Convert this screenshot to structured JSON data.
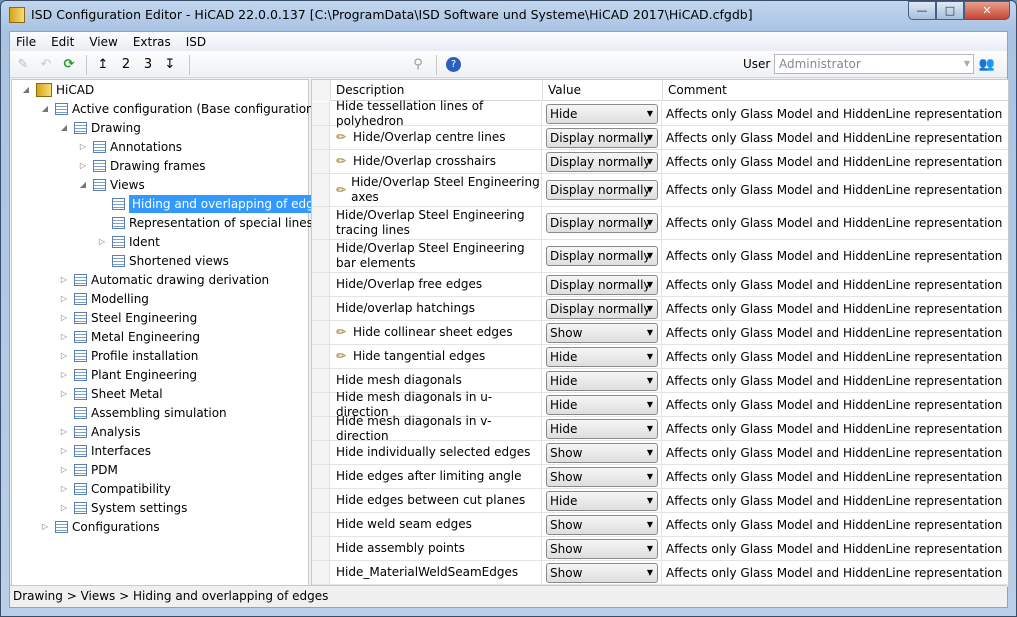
{
  "window": {
    "title": "ISD Configuration Editor  - HiCAD 22.0.0.137 [C:\\ProgramData\\ISD Software und Systeme\\HiCAD 2017\\HiCAD.cfgdb]",
    "minimize": "—",
    "maximize": "□",
    "close": "✕"
  },
  "menu": [
    "File",
    "Edit",
    "View",
    "Extras",
    "ISD"
  ],
  "toolbar": {
    "user_label": "User",
    "user_value": "Administrator"
  },
  "tree": [
    {
      "label": "HiCAD",
      "level": 0,
      "exp": "◢",
      "root": true
    },
    {
      "label": "Active configuration (Base configuration)",
      "level": 1,
      "exp": "◢"
    },
    {
      "label": "Drawing",
      "level": 2,
      "exp": "◢"
    },
    {
      "label": "Annotations",
      "level": 3,
      "exp": "▷"
    },
    {
      "label": "Drawing frames",
      "level": 3,
      "exp": "▷"
    },
    {
      "label": "Views",
      "level": 3,
      "exp": "◢"
    },
    {
      "label": "Hiding and overlapping of edges",
      "level": 4,
      "exp": "",
      "selected": true
    },
    {
      "label": "Representation of special lines",
      "level": 4,
      "exp": ""
    },
    {
      "label": "Ident",
      "level": 4,
      "exp": "▷"
    },
    {
      "label": "Shortened views",
      "level": 4,
      "exp": ""
    },
    {
      "label": "Automatic drawing derivation",
      "level": 2,
      "exp": "▷"
    },
    {
      "label": "Modelling",
      "level": 2,
      "exp": "▷"
    },
    {
      "label": "Steel Engineering",
      "level": 2,
      "exp": "▷"
    },
    {
      "label": "Metal Engineering",
      "level": 2,
      "exp": "▷"
    },
    {
      "label": "Profile installation",
      "level": 2,
      "exp": "▷"
    },
    {
      "label": "Plant Engineering",
      "level": 2,
      "exp": "▷"
    },
    {
      "label": "Sheet Metal",
      "level": 2,
      "exp": "▷"
    },
    {
      "label": "Assembling simulation",
      "level": 2,
      "exp": ""
    },
    {
      "label": "Analysis",
      "level": 2,
      "exp": "▷"
    },
    {
      "label": "Interfaces",
      "level": 2,
      "exp": "▷"
    },
    {
      "label": "PDM",
      "level": 2,
      "exp": "▷"
    },
    {
      "label": "Compatibility",
      "level": 2,
      "exp": "▷"
    },
    {
      "label": "System settings",
      "level": 2,
      "exp": "▷"
    },
    {
      "label": "Configurations",
      "level": 1,
      "exp": "▷"
    }
  ],
  "grid": {
    "headers": {
      "description": "Description",
      "value": "Value",
      "comment": "Comment"
    },
    "rows": [
      {
        "d": "Hide tessellation lines of polyhedron",
        "v": "Hide",
        "pen": false,
        "tall": false
      },
      {
        "d": "Hide/Overlap centre lines",
        "v": "Display normally",
        "pen": true,
        "tall": false
      },
      {
        "d": "Hide/Overlap crosshairs",
        "v": "Display normally",
        "pen": true,
        "tall": false
      },
      {
        "d": "Hide/Overlap Steel Engineering axes",
        "v": "Display normally",
        "pen": true,
        "tall": true
      },
      {
        "d": "Hide/Overlap Steel Engineering tracing lines",
        "v": "Display normally",
        "pen": false,
        "tall": true
      },
      {
        "d": "Hide/Overlap Steel Engineering bar elements",
        "v": "Display normally",
        "pen": false,
        "tall": true
      },
      {
        "d": "Hide/Overlap free edges",
        "v": "Display normally",
        "pen": false,
        "tall": false
      },
      {
        "d": "Hide/overlap hatchings",
        "v": "Display normally",
        "pen": false,
        "tall": false
      },
      {
        "d": "Hide collinear sheet edges",
        "v": "Show",
        "pen": true,
        "tall": false
      },
      {
        "d": "Hide tangential edges",
        "v": "Hide",
        "pen": true,
        "tall": false
      },
      {
        "d": "Hide mesh diagonals",
        "v": "Hide",
        "pen": false,
        "tall": false
      },
      {
        "d": "Hide mesh diagonals in u-direction",
        "v": "Hide",
        "pen": false,
        "tall": false
      },
      {
        "d": "Hide mesh diagonals in v-direction",
        "v": "Hide",
        "pen": false,
        "tall": false
      },
      {
        "d": "Hide individually selected edges",
        "v": "Show",
        "pen": false,
        "tall": false
      },
      {
        "d": "Hide edges after limiting angle",
        "v": "Show",
        "pen": false,
        "tall": false
      },
      {
        "d": "Hide edges between cut planes",
        "v": "Hide",
        "pen": false,
        "tall": false
      },
      {
        "d": "Hide weld seam edges",
        "v": "Show",
        "pen": false,
        "tall": false
      },
      {
        "d": "Hide assembly points",
        "v": "Show",
        "pen": false,
        "tall": false
      },
      {
        "d": "Hide_MaterialWeldSeamEdges",
        "v": "Show",
        "pen": false,
        "tall": false
      }
    ],
    "comment": "Affects only Glass Model and HiddenLine representation"
  },
  "status": "Drawing > Views > Hiding and overlapping of edges"
}
